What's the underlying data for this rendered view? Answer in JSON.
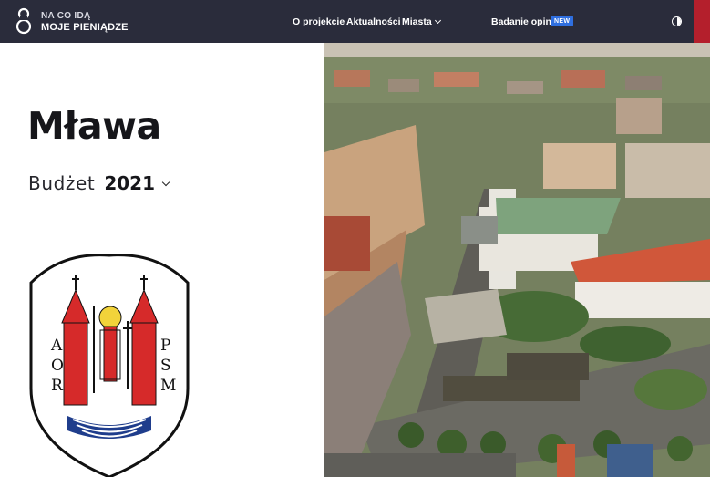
{
  "header": {
    "logo_line1": "NA CO IDĄ",
    "logo_line2": "MOJE PIENIĄDZE",
    "nav": {
      "about": "O projekcie",
      "news": "Aktualności",
      "cities": "Miasta",
      "survey": "Badanie opinii",
      "new_badge": "NEW"
    },
    "contrast_icon": "contrast-icon",
    "accent_color": "#b41f2c",
    "bar_color": "#2a2c3b",
    "badge_color": "#2f6fe0"
  },
  "main": {
    "city": "Mława",
    "budget_label": "Budżet",
    "budget_year": "2021",
    "crest_letters_left": [
      "A",
      "O",
      "R"
    ],
    "crest_letters_right": [
      "P",
      "S",
      "M"
    ]
  },
  "images": {
    "crest": "coat-of-arms-mlawa",
    "photo": "aerial-photo-town-square"
  }
}
